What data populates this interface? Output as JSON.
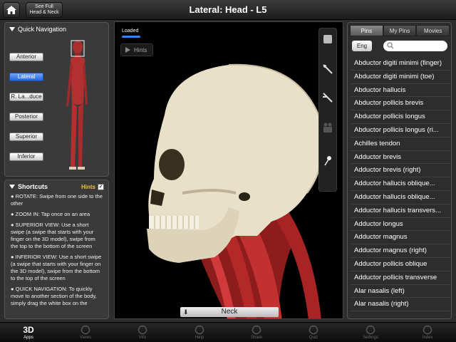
{
  "header": {
    "title": "Lateral: Head - L5",
    "see_full_line1": "See Full",
    "see_full_line2": "Head & Neck",
    "home_icon": "home-icon"
  },
  "quick_nav": {
    "title": "Quick Navigation",
    "buttons": [
      "Anterior",
      "Lateral",
      "R. La...duce",
      "Posterior",
      "Superior",
      "Inferior"
    ],
    "active": "Lateral"
  },
  "shortcuts": {
    "title": "Shortcuts",
    "hints_label": "Hints",
    "hints_checked": "✓",
    "items": [
      "● ROTATE: Swipe from one side to the other",
      "● ZOOM IN: Tap once on an area",
      "● SUPERIOR VIEW: Use a short swipe (a swipe that starts with your finger on the 3D model), swipe from the top to the bottom of the screen",
      "● INFERIOR VIEW: Use a short swipe (a swipe that starts with your finger on the 3D model), swipe from the bottom to the top of the screen",
      "● QUICK NAVIGATION: To quickly move to another section of the body, simply drag the white box on the"
    ]
  },
  "viewer": {
    "loaded_label": "Loaded",
    "hints_button": "Hints",
    "bottom_label": "Neck"
  },
  "right_panel": {
    "tabs": [
      "Pins",
      "My Pins",
      "Movies"
    ],
    "active_tab": "Pins",
    "lang_button": "Eng",
    "search_placeholder": "",
    "items": [
      "Abductor digiti minimi (finger)",
      "Abductor digiti minimi (toe)",
      "Abductor hallucis",
      "Abductor pollicis brevis",
      "Abductor pollicis longus",
      "Abductor pollicis longus (ri...",
      "Achilles tendon",
      "Adductor brevis",
      "Adductor brevis (right)",
      "Adductor hallucis oblique...",
      "Adductor hallucis oblique...",
      "Adductor hallucis transvers...",
      "Adductor longus",
      "Adductor magnus",
      "Adductor magnus (right)",
      "Adductor pollicis oblique",
      "Adductor pollicis transverse",
      "Alar nasalis (left)",
      "Alar nasalis (right)"
    ]
  },
  "tabbar": {
    "items": [
      "Apps",
      "Views",
      "Info",
      "Help",
      "Share",
      "Quiz",
      "Settings",
      "Index"
    ],
    "active": "Apps",
    "apps_icon_text": "3D"
  },
  "colors": {
    "accent": "#2766d8",
    "hints_yellow": "#f0c040",
    "muscle_red": "#b02020",
    "bone": "#e8e0c8"
  }
}
